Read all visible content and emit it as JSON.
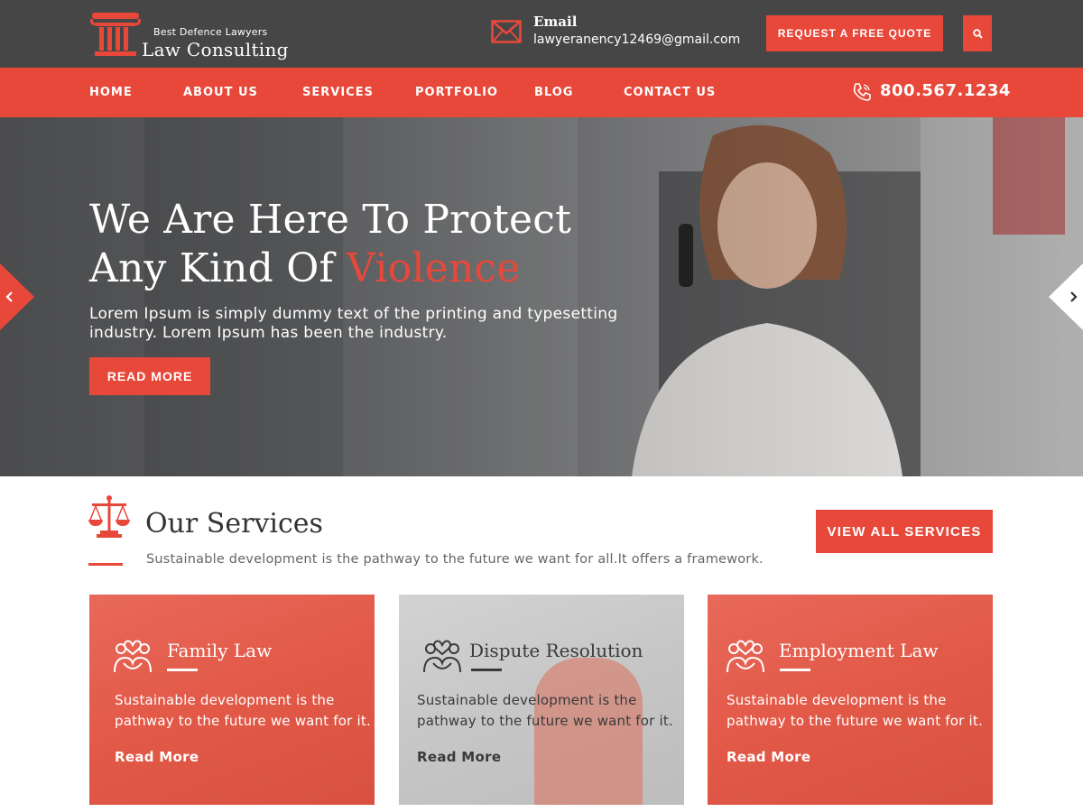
{
  "brand": {
    "tagline": "Best Defence Lawyers",
    "name": "Law Consulting",
    "accent_color": "#e8483a",
    "dark_color": "#464646"
  },
  "header": {
    "email_label": "Email",
    "email_value": "lawyeranency12469@gmail.com",
    "quote_button": "REQUEST A FREE QUOTE",
    "search_icon": "search-icon"
  },
  "nav": {
    "items": [
      "HOME",
      "ABOUT US",
      "SERVICES",
      "PORTFOLIO",
      "BLOG",
      "CONTACT US"
    ],
    "phone": "800.567.1234"
  },
  "hero": {
    "title_line1": "We Are Here To Protect",
    "title_line2_prefix": "Any Kind Of ",
    "title_line2_accent": "Violence",
    "description": "Lorem Ipsum is simply dummy text of the printing and typesetting industry. Lorem Ipsum has been the industry.",
    "button": "READ MORE"
  },
  "services": {
    "title": "Our Services",
    "subtitle": "Sustainable development is the pathway to the future we want for all.It offers a framework.",
    "view_all": "VIEW ALL SERVICES",
    "cards": [
      {
        "title": "Family Law",
        "text": "Sustainable development is the pathway to the future we want for it.",
        "link": "Read More"
      },
      {
        "title": "Dispute Resolution",
        "text": "Sustainable development is the pathway to the future we want for it.",
        "link": "Read More"
      },
      {
        "title": "Employment Law",
        "text": "Sustainable development is the pathway to the future we want for it.",
        "link": "Read More"
      }
    ]
  }
}
